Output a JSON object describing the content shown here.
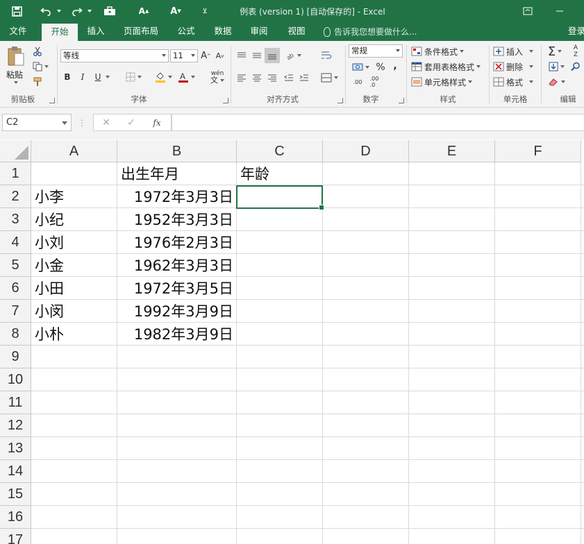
{
  "title_bar": {
    "doc_title": "例表 (version 1) [自动保存的] - Excel",
    "icons": [
      "save-icon",
      "undo-icon",
      "redo-icon",
      "toolbox-icon",
      "font-increase-icon",
      "font-decrease-icon",
      "customize-qat-icon"
    ]
  },
  "tabs": [
    "文件",
    "开始",
    "插入",
    "页面布局",
    "公式",
    "数据",
    "审阅",
    "视图"
  ],
  "tell_me": "告诉我您想要做什么...",
  "login": "登录",
  "ribbon": {
    "clipboard": {
      "paste": "粘贴",
      "label": "剪贴板"
    },
    "font": {
      "name": "等线",
      "size": "11",
      "bold": "B",
      "italic": "I",
      "underline": "U",
      "phonetic": "wén",
      "label": "字体"
    },
    "alignment": {
      "label": "对齐方式"
    },
    "number": {
      "format": "常规",
      "percent": "%",
      "comma": ",",
      "inc_decimal": ".00",
      "label": "数字"
    },
    "styles": {
      "conditional": "条件格式",
      "table": "套用表格格式",
      "cell": "单元格样式",
      "label": "样式"
    },
    "cells": {
      "insert": "插入",
      "delete": "删除",
      "format": "格式",
      "label": "单元格"
    },
    "editing": {
      "sum": "Σ",
      "label": "编辑"
    }
  },
  "formula_bar": {
    "name_box": "C2",
    "cancel": "✕",
    "enter": "✓",
    "fx": "fx",
    "value": ""
  },
  "sheet": {
    "columns": [
      "A",
      "B",
      "C",
      "D",
      "E",
      "F"
    ],
    "rows": [
      "1",
      "2",
      "3",
      "4",
      "5",
      "6",
      "7",
      "8",
      "9",
      "10",
      "11",
      "12",
      "13",
      "14",
      "15",
      "16",
      "17"
    ],
    "cells": [
      [
        "",
        "出生年月",
        "年龄"
      ],
      [
        "小李",
        "1972年3月3日",
        ""
      ],
      [
        "小纪",
        "1952年3月3日",
        ""
      ],
      [
        "小刘",
        "1976年2月3日",
        ""
      ],
      [
        "小金",
        "1962年3月3日",
        ""
      ],
      [
        "小田",
        "1972年3月5日",
        ""
      ],
      [
        "小闵",
        "1992年3月9日",
        ""
      ],
      [
        "小朴",
        "1982年3月9日",
        ""
      ]
    ],
    "selected_cell": "C2"
  },
  "colors": {
    "excel_green": "#217346",
    "ribbon_bg": "#f3f3f3"
  }
}
